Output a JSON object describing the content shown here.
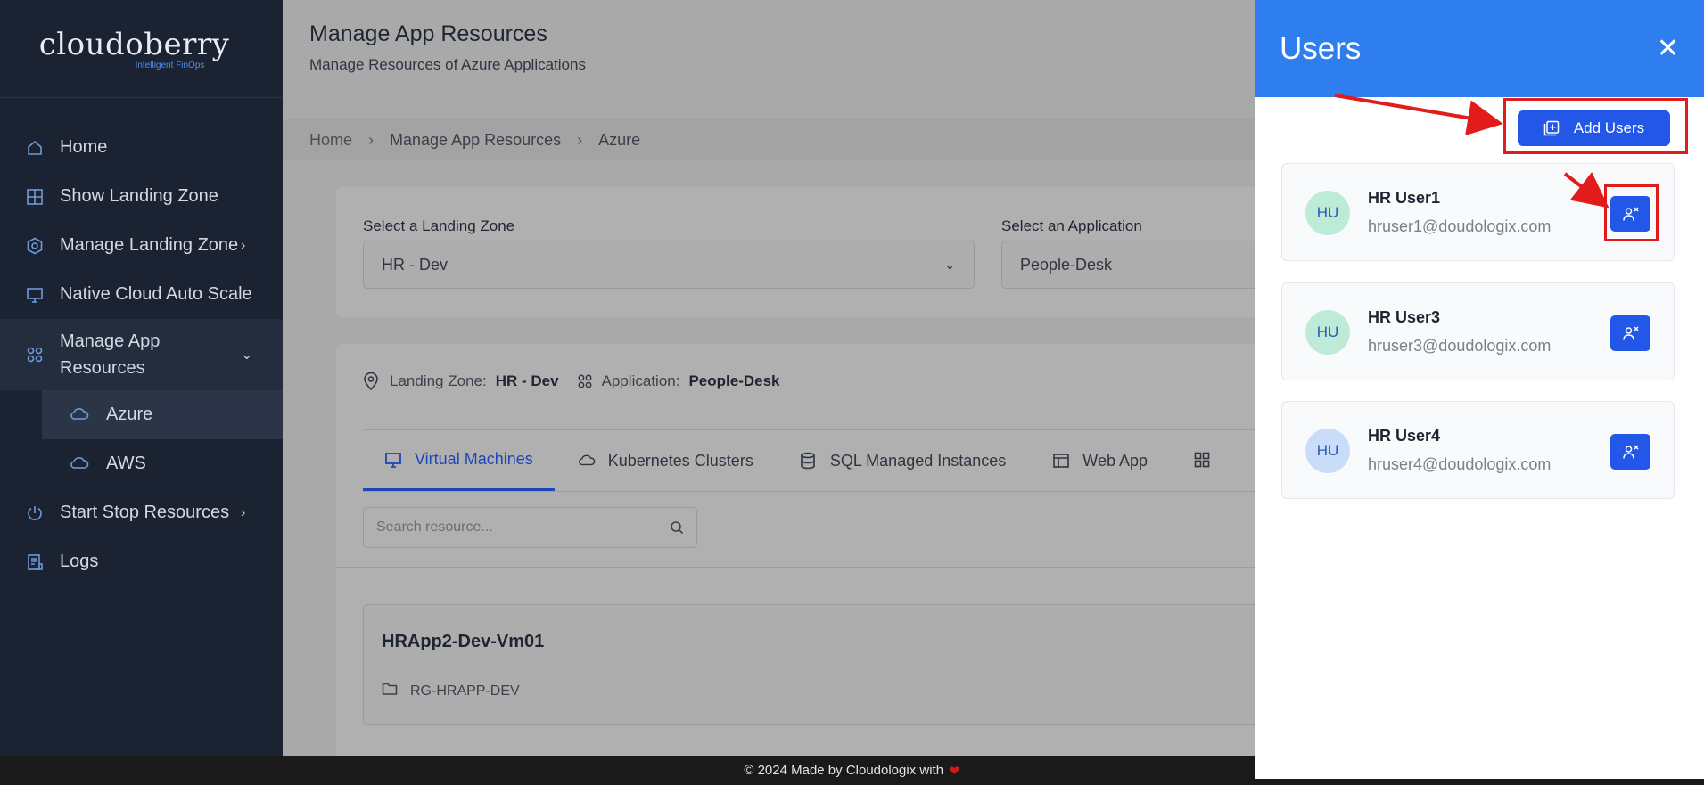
{
  "logo": {
    "name": "cloudoberry",
    "tagline": "Intelligent FinOps"
  },
  "sidebar": {
    "items": [
      {
        "label": "Home",
        "icon": "home-icon"
      },
      {
        "label": "Show Landing Zone",
        "icon": "grid-icon"
      },
      {
        "label": "Manage Landing Zone",
        "icon": "hexagon-gear-icon"
      },
      {
        "label": "Native Cloud Auto Scale",
        "icon": "monitor-icon"
      },
      {
        "label": "Manage App Resources",
        "icon": "apps-icon"
      },
      {
        "label": "Start Stop Resources",
        "icon": "power-icon"
      },
      {
        "label": "Logs",
        "icon": "log-icon"
      }
    ],
    "sub_items": [
      {
        "label": "Azure",
        "icon": "cloud-icon"
      },
      {
        "label": "AWS",
        "icon": "cloud-icon"
      }
    ]
  },
  "header": {
    "title": "Manage App Resources",
    "subtitle": "Manage Resources of Azure Applications"
  },
  "breadcrumb": {
    "home": "Home",
    "section": "Manage App Resources",
    "current": "Azure"
  },
  "filters": {
    "landing_zone_label": "Select a Landing Zone",
    "landing_zone_value": "HR - Dev",
    "application_label": "Select an Application",
    "application_value": "People-Desk"
  },
  "meta": {
    "landing_zone_label": "Landing Zone:",
    "landing_zone_value": "HR - Dev",
    "application_label": "Application:",
    "application_value": "People-Desk"
  },
  "tabs": [
    {
      "label": "Virtual Machines",
      "icon": "monitor-icon",
      "active": true
    },
    {
      "label": "Kubernetes Clusters",
      "icon": "cloud-icon"
    },
    {
      "label": "SQL Managed Instances",
      "icon": "database-icon"
    },
    {
      "label": "Web App",
      "icon": "browser-icon"
    }
  ],
  "search": {
    "placeholder": "Search resource..."
  },
  "resource": {
    "name": "HRApp2-Dev-Vm01",
    "group": "RG-HRAPP-DEV"
  },
  "footer": {
    "text": "© 2024 Made by Cloudologix with"
  },
  "drawer": {
    "title": "Users",
    "add_button": "Add Users",
    "users": [
      {
        "initials": "HU",
        "name": "HR User1",
        "email": "hruser1@doudologix.com"
      },
      {
        "initials": "HU",
        "name": "HR User3",
        "email": "hruser3@doudologix.com"
      },
      {
        "initials": "HU",
        "name": "HR User4",
        "email": "hruser4@doudologix.com"
      }
    ]
  },
  "colors": {
    "sidebar_bg": "#1b2333",
    "drawer_header": "#2f7ef0",
    "primary_button": "#2357e8",
    "annotation_red": "#e21b1b"
  }
}
